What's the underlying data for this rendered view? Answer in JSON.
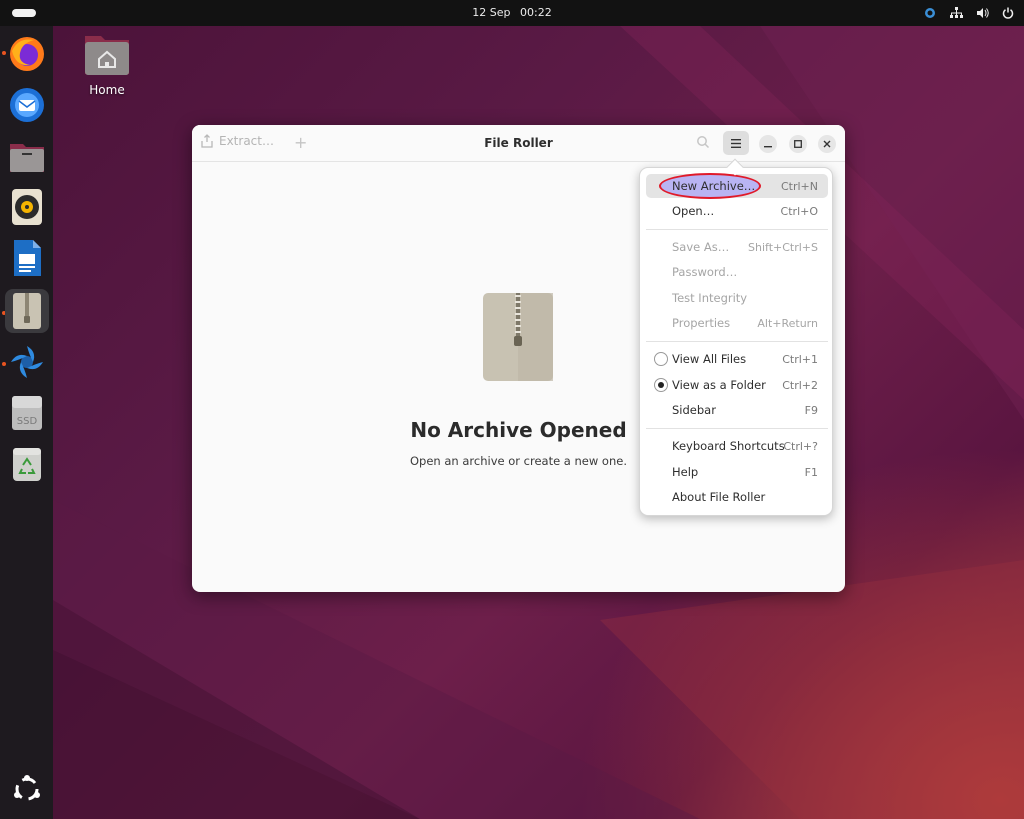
{
  "topbar": {
    "date": "12 Sep",
    "time": "00:22",
    "tray_icons": [
      "screen-share-icon",
      "network-icon",
      "volume-icon",
      "power-icon"
    ]
  },
  "dock": {
    "apps": [
      {
        "name": "firefox",
        "running": true
      },
      {
        "name": "thunderbird",
        "running": false
      },
      {
        "name": "files",
        "running": false
      },
      {
        "name": "rhythmbox",
        "running": false
      },
      {
        "name": "libreoffice-writer",
        "running": false
      },
      {
        "name": "file-roller",
        "running": true,
        "active": true
      },
      {
        "name": "app-center",
        "running": true
      },
      {
        "name": "ssd-drive",
        "running": false,
        "label": "SSD"
      },
      {
        "name": "trash",
        "running": false
      },
      {
        "name": "show-apps",
        "running": false
      }
    ]
  },
  "desktop": {
    "home_label": "Home"
  },
  "window": {
    "title": "File Roller",
    "extract_label": "Extract…",
    "empty_title": "No Archive Opened",
    "empty_subtitle": "Open an archive or create a new one."
  },
  "menu": {
    "items": [
      {
        "label": "New Archive…",
        "accel": "Ctrl+N",
        "highlighted": true
      },
      {
        "label": "Open…",
        "accel": "Ctrl+O"
      },
      {
        "label": "Save As…",
        "accel": "Shift+Ctrl+S",
        "disabled": true
      },
      {
        "label": "Password…",
        "accel": "",
        "disabled": true
      },
      {
        "label": "Test Integrity",
        "accel": "",
        "disabled": true
      },
      {
        "label": "Properties",
        "accel": "Alt+Return",
        "disabled": true
      },
      {
        "label": "View All Files",
        "accel": "Ctrl+1",
        "radio": false
      },
      {
        "label": "View as a Folder",
        "accel": "Ctrl+2",
        "radio": true
      },
      {
        "label": "Sidebar",
        "accel": "F9"
      },
      {
        "label": "Keyboard Shortcuts",
        "accel": "Ctrl+?"
      },
      {
        "label": "Help",
        "accel": "F1"
      },
      {
        "label": "About File Roller",
        "accel": ""
      }
    ]
  },
  "colors": {
    "accent": "#e95420",
    "annotation_ring": "#e01a2a",
    "annotation_fill": "#9a8cff"
  }
}
